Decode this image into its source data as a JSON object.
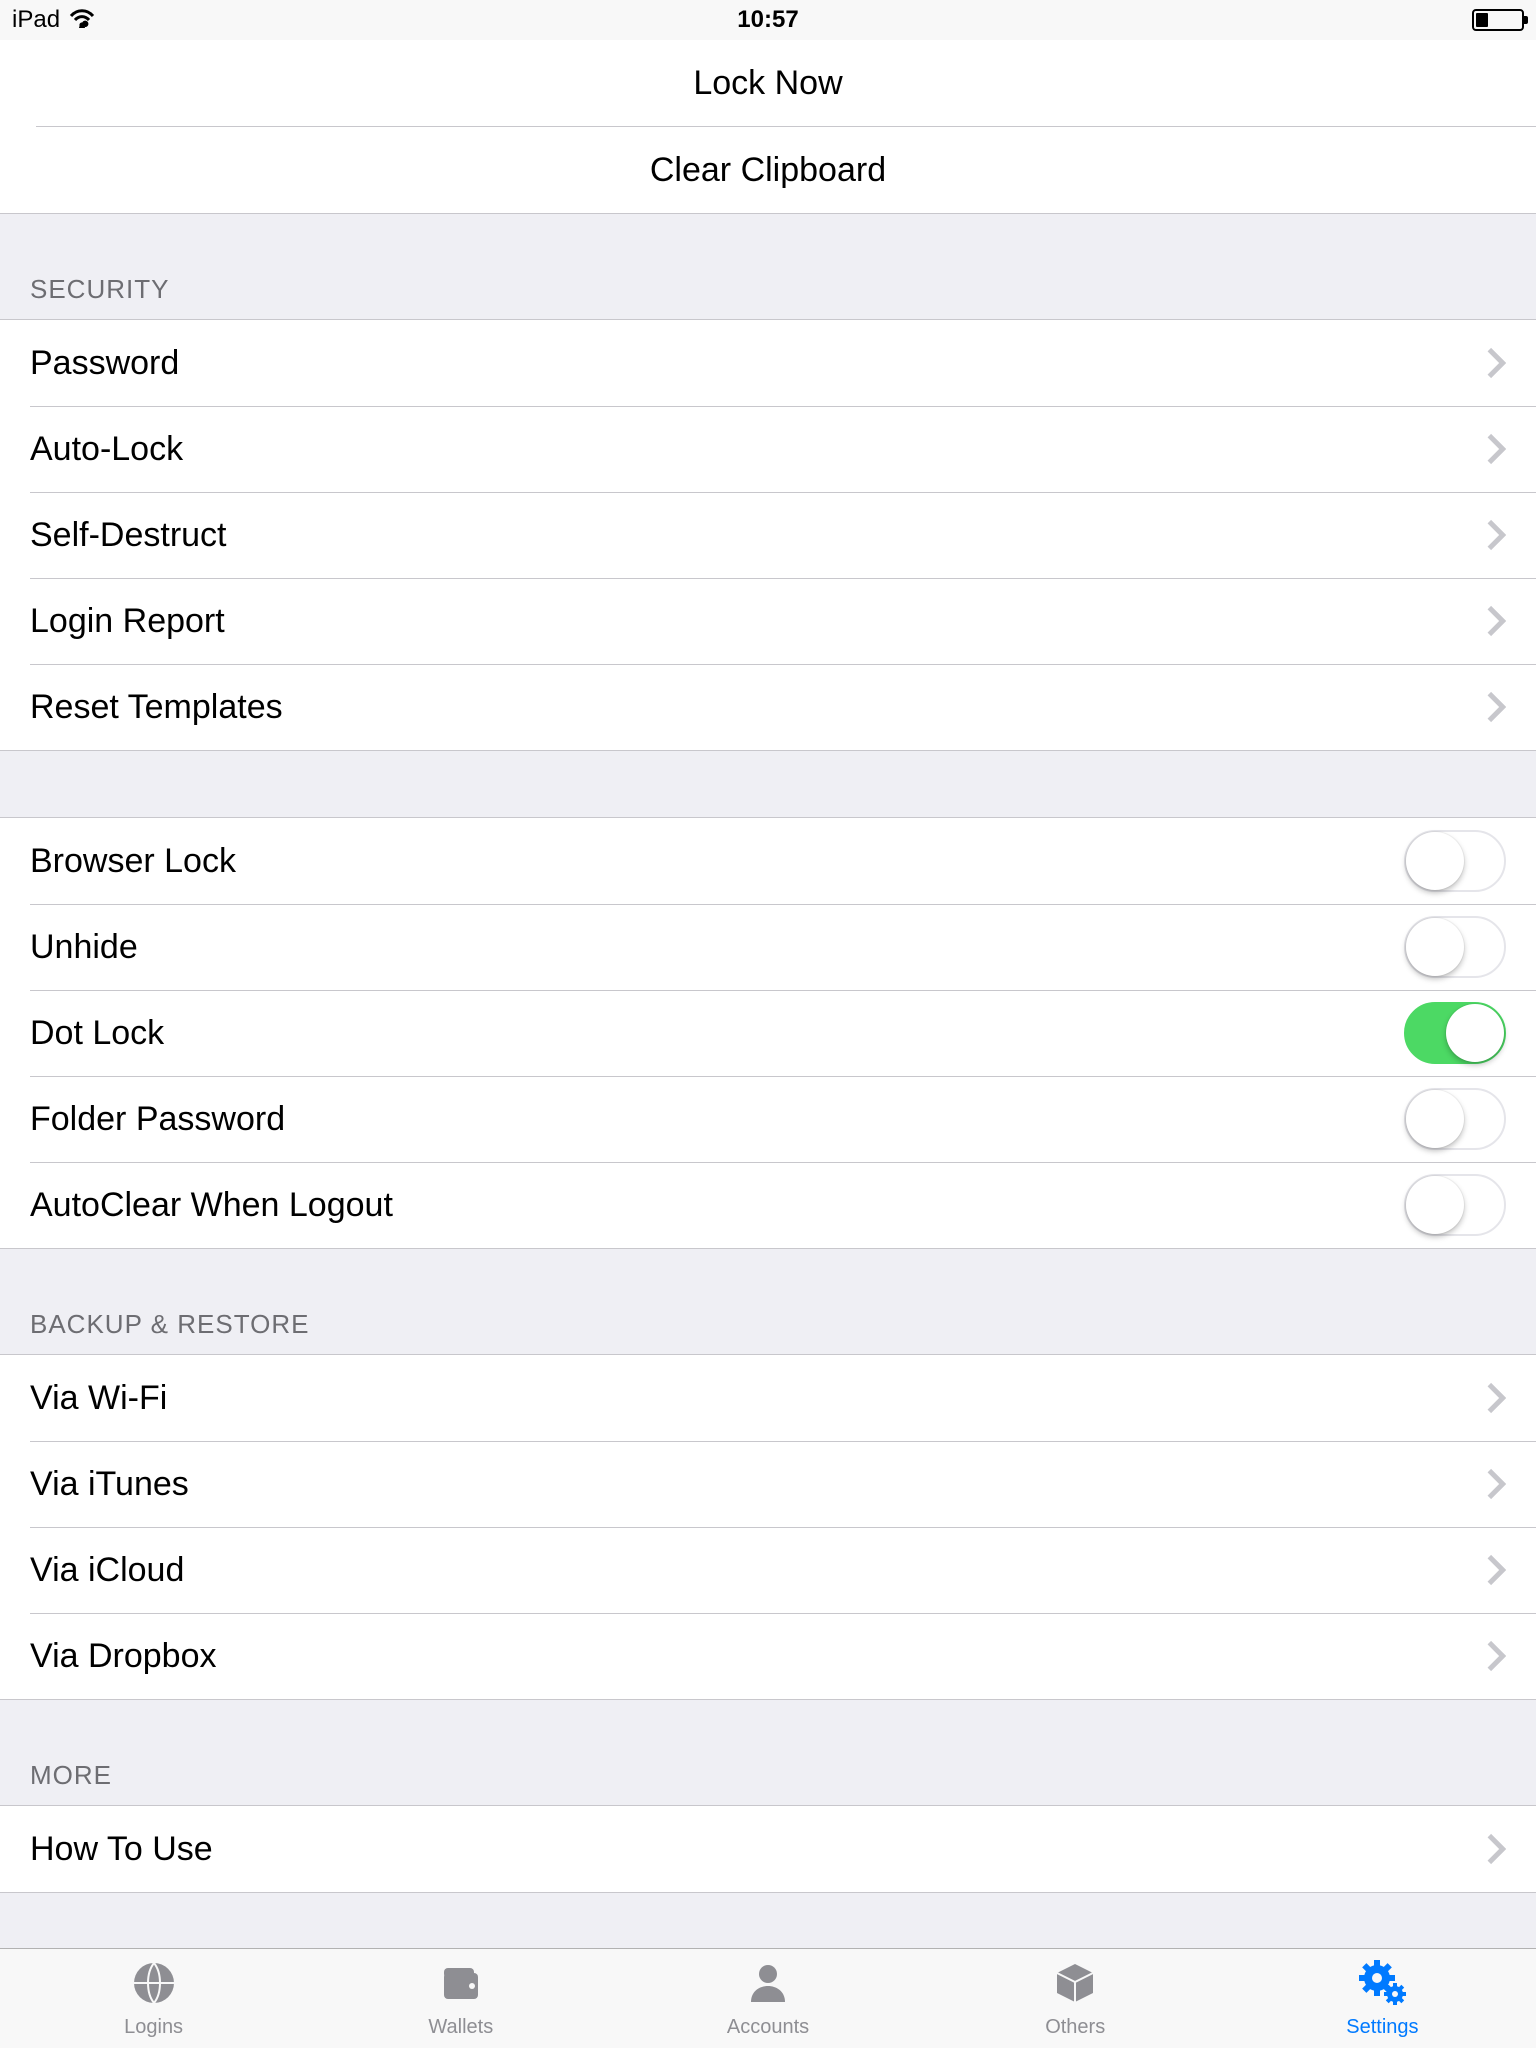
{
  "status": {
    "device": "iPad",
    "time": "10:57"
  },
  "topActions": {
    "lockNow": "Lock Now",
    "clearClipboard": "Clear Clipboard"
  },
  "headers": {
    "security": "SECURITY",
    "backup": "BACKUP & RESTORE",
    "more": "MORE"
  },
  "security": {
    "password": "Password",
    "autoLock": "Auto-Lock",
    "selfDestruct": "Self-Destruct",
    "loginReport": "Login Report",
    "resetTemplates": "Reset Templates"
  },
  "toggles": {
    "browserLock": {
      "label": "Browser Lock",
      "on": false
    },
    "unhide": {
      "label": "Unhide",
      "on": false
    },
    "dotLock": {
      "label": "Dot Lock",
      "on": true
    },
    "folderPassword": {
      "label": "Folder Password",
      "on": false
    },
    "autoClear": {
      "label": "AutoClear When Logout",
      "on": false
    }
  },
  "backup": {
    "wifi": "Via Wi-Fi",
    "itunes": "Via iTunes",
    "icloud": "Via iCloud",
    "dropbox": "Via Dropbox"
  },
  "more": {
    "howToUse": "How To Use"
  },
  "tabs": {
    "logins": "Logins",
    "wallets": "Wallets",
    "accounts": "Accounts",
    "others": "Others",
    "settings": "Settings"
  }
}
